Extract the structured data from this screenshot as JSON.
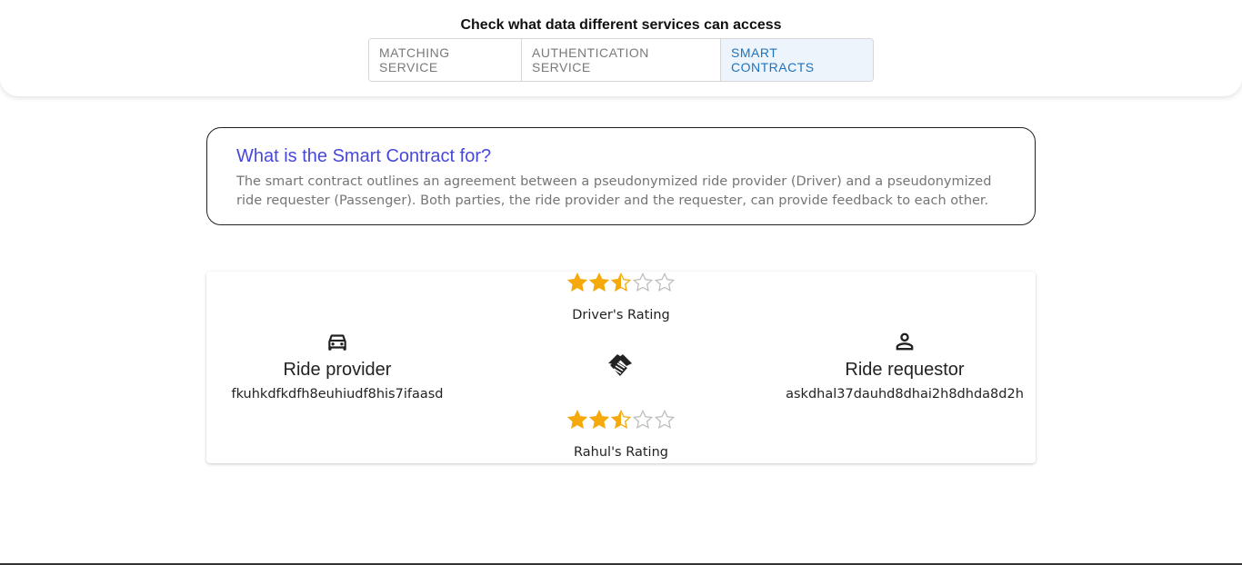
{
  "header": {
    "title": "Check what data different services can access",
    "tabs": [
      {
        "label": "MATCHING SERVICE",
        "active": false
      },
      {
        "label": "AUTHENTICATION SERVICE",
        "active": false
      },
      {
        "label": "SMART CONTRACTS",
        "active": true
      }
    ]
  },
  "info": {
    "title": "What is the Smart Contract for?",
    "text": "The smart contract outlines an agreement between a pseudonymized ride provider (Driver) and a pseudonymized ride requester (Passenger). Both parties, the ride provider and the requester, can provide feedback to each other."
  },
  "contract": {
    "provider": {
      "name": "Ride provider",
      "id": "fkuhkdfkdfh8euhiudf8his7ifaasd",
      "icon": "car-icon"
    },
    "requestor": {
      "name": "Ride requestor",
      "id": "askdhal37dauhd8dhai2h8dhda8d2h",
      "icon": "person-icon"
    },
    "center_icon": "handshake-icon",
    "driver_rating": {
      "label": "Driver's Rating",
      "value": 2.5,
      "max": 5
    },
    "passenger_rating": {
      "label": "Rahul's Rating",
      "value": 2.5,
      "max": 5
    }
  },
  "colors": {
    "accent": "#1e73be",
    "info_title": "#4848d8",
    "star_filled": "#f5a90a",
    "star_empty": "#bdbdbd"
  }
}
